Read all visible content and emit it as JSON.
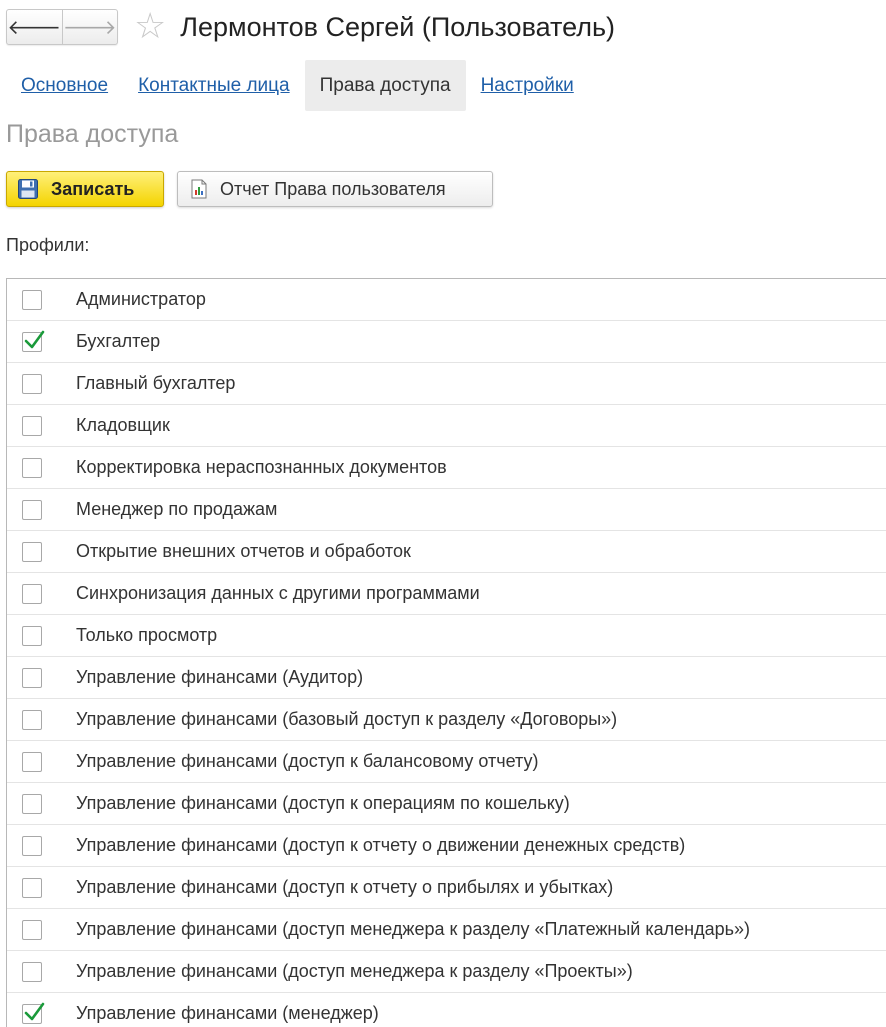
{
  "window": {
    "title": "Лермонтов Сергей (Пользователь)",
    "back_glyph": "🡐",
    "forward_glyph": "🡒",
    "star_glyph": "☆"
  },
  "tabs": [
    {
      "label": "Основное",
      "active": false
    },
    {
      "label": "Контактные лица",
      "active": false
    },
    {
      "label": "Права доступа",
      "active": true
    },
    {
      "label": "Настройки",
      "active": false
    }
  ],
  "section": {
    "title": "Права доступа"
  },
  "toolbar": {
    "save_label": "Записать",
    "report_label": "Отчет Права пользователя"
  },
  "profiles": {
    "label": "Профили:",
    "items": [
      {
        "label": "Администратор",
        "checked": false
      },
      {
        "label": "Бухгалтер",
        "checked": true
      },
      {
        "label": "Главный бухгалтер",
        "checked": false
      },
      {
        "label": "Кладовщик",
        "checked": false
      },
      {
        "label": "Корректировка нераспознанных документов",
        "checked": false
      },
      {
        "label": "Менеджер по продажам",
        "checked": false
      },
      {
        "label": "Открытие внешних отчетов и обработок",
        "checked": false
      },
      {
        "label": "Синхронизация данных с другими программами",
        "checked": false
      },
      {
        "label": "Только просмотр",
        "checked": false
      },
      {
        "label": "Управление финансами (Аудитор)",
        "checked": false
      },
      {
        "label": "Управление финансами (базовый доступ к разделу «Договоры»)",
        "checked": false
      },
      {
        "label": "Управление финансами (доступ к балансовому отчету)",
        "checked": false
      },
      {
        "label": "Управление финансами (доступ к операциям по кошельку)",
        "checked": false
      },
      {
        "label": "Управление финансами (доступ к отчету о движении денежных средств)",
        "checked": false
      },
      {
        "label": "Управление финансами (доступ к отчету о прибылях и убытках)",
        "checked": false
      },
      {
        "label": "Управление финансами (доступ менеджера к разделу «Платежный календарь»)",
        "checked": false
      },
      {
        "label": "Управление финансами (доступ менеджера к разделу «Проекты»)",
        "checked": false
      },
      {
        "label": "Управление финансами (менеджер)",
        "checked": true
      }
    ]
  },
  "colors": {
    "link": "#1f5fa8",
    "check": "#1a9a3a",
    "primary_button": "#f4d400",
    "section_title": "#999999"
  },
  "icons": {
    "back": "arrow-left-icon",
    "forward": "arrow-right-icon",
    "favorite": "star-icon",
    "save": "floppy-disk-icon",
    "report": "report-document-icon",
    "check": "checkmark-icon"
  }
}
